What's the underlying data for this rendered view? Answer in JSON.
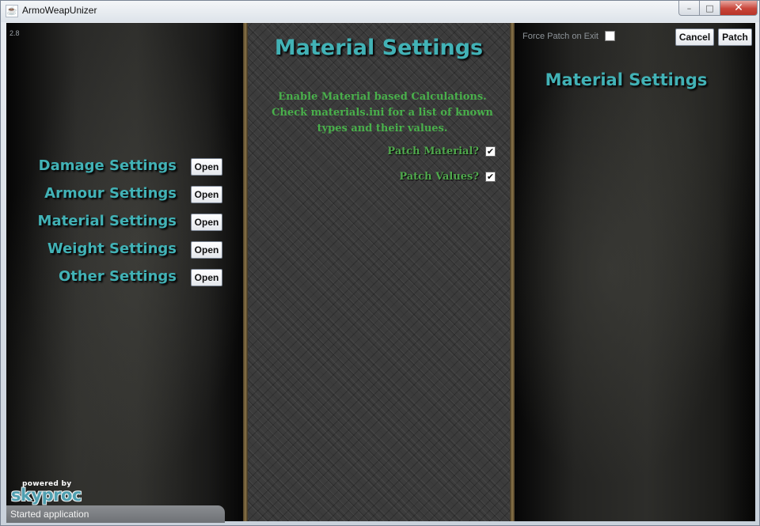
{
  "window": {
    "title": "ArmoWeapUnizer",
    "minimize_glyph": "–",
    "maximize_glyph": "□",
    "close_glyph": "✕"
  },
  "version": "2.8",
  "left_nav": {
    "items": [
      {
        "label": "Damage Settings",
        "button": "Open"
      },
      {
        "label": "Armour Settings",
        "button": "Open"
      },
      {
        "label": "Material Settings",
        "button": "Open"
      },
      {
        "label": "Weight Settings",
        "button": "Open"
      },
      {
        "label": "Other Settings",
        "button": "Open"
      }
    ]
  },
  "middle": {
    "title": "Material Settings",
    "description_lines": [
      "Enable Material based Calculations.",
      "Check materials.ini for a list of known",
      "types and their values."
    ],
    "options": [
      {
        "label": "Patch Material?",
        "checked": true,
        "glyph": "✔"
      },
      {
        "label": "Patch Values?",
        "checked": true,
        "glyph": "✔"
      }
    ]
  },
  "right": {
    "force_patch_label": "Force Patch on Exit",
    "force_patch_checked": false,
    "cancel_label": "Cancel",
    "patch_label": "Patch",
    "title": "Material Settings"
  },
  "logo": {
    "small": "powered by",
    "big": "skyproc"
  },
  "status": {
    "text": "Started application"
  },
  "colors": {
    "accent_teal": "#42b2b6",
    "option_green": "#49b04b"
  }
}
